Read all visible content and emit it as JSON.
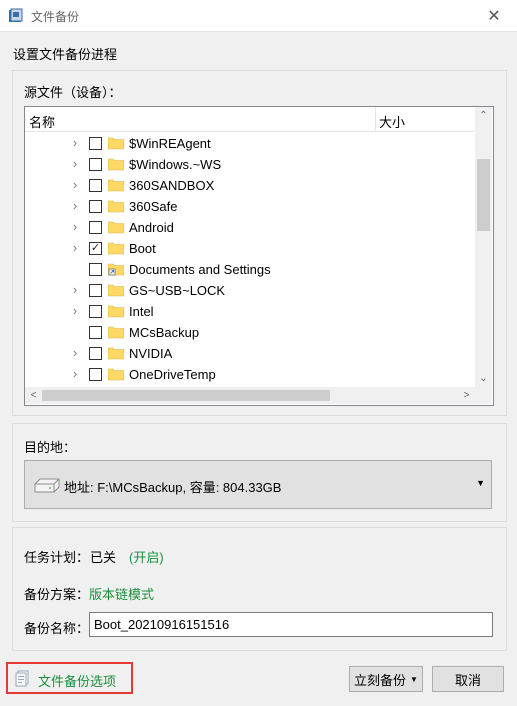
{
  "window": {
    "title": "文件备份",
    "close_glyph": "✕"
  },
  "section_title": "设置文件备份进程",
  "source": {
    "label": "源文件（设备）：",
    "columns": {
      "name": "名称",
      "size": "大小"
    },
    "items": [
      {
        "label": "$WinREAgent",
        "expandable": true,
        "checked": false,
        "icon": "folder-icon"
      },
      {
        "label": "$Windows.~WS",
        "expandable": true,
        "checked": false,
        "icon": "folder-icon"
      },
      {
        "label": "360SANDBOX",
        "expandable": true,
        "checked": false,
        "icon": "folder-icon"
      },
      {
        "label": "360Safe",
        "expandable": true,
        "checked": false,
        "icon": "folder-icon"
      },
      {
        "label": "Android",
        "expandable": true,
        "checked": false,
        "icon": "folder-icon"
      },
      {
        "label": "Boot",
        "expandable": true,
        "checked": true,
        "icon": "folder-icon"
      },
      {
        "label": "Documents and Settings",
        "expandable": false,
        "checked": false,
        "icon": "folder-shortcut-icon"
      },
      {
        "label": "GS~USB~LOCK",
        "expandable": true,
        "checked": false,
        "icon": "folder-icon"
      },
      {
        "label": "Intel",
        "expandable": true,
        "checked": false,
        "icon": "folder-icon"
      },
      {
        "label": "MCsBackup",
        "expandable": false,
        "checked": false,
        "icon": "folder-icon"
      },
      {
        "label": "NVIDIA",
        "expandable": true,
        "checked": false,
        "icon": "folder-icon"
      },
      {
        "label": "OneDriveTemp",
        "expandable": true,
        "checked": false,
        "icon": "folder-icon"
      }
    ]
  },
  "destination": {
    "label": "目的地：",
    "value": "地址: F:\\MCsBackup, 容量: 804.33GB"
  },
  "task": {
    "label": "任务计划：",
    "value": "已关",
    "link": "(开启)"
  },
  "scheme": {
    "label": "备份方案：",
    "link": "版本链模式"
  },
  "backup_name": {
    "label": "备份名称：",
    "value": "Boot_20210916151516"
  },
  "options_link": "文件备份选项",
  "buttons": {
    "backup": "立刻备份",
    "cancel": "取消"
  },
  "colors": {
    "link": "#1a8f3c",
    "highlight_border": "#e53935",
    "folder": "#ffd866"
  }
}
